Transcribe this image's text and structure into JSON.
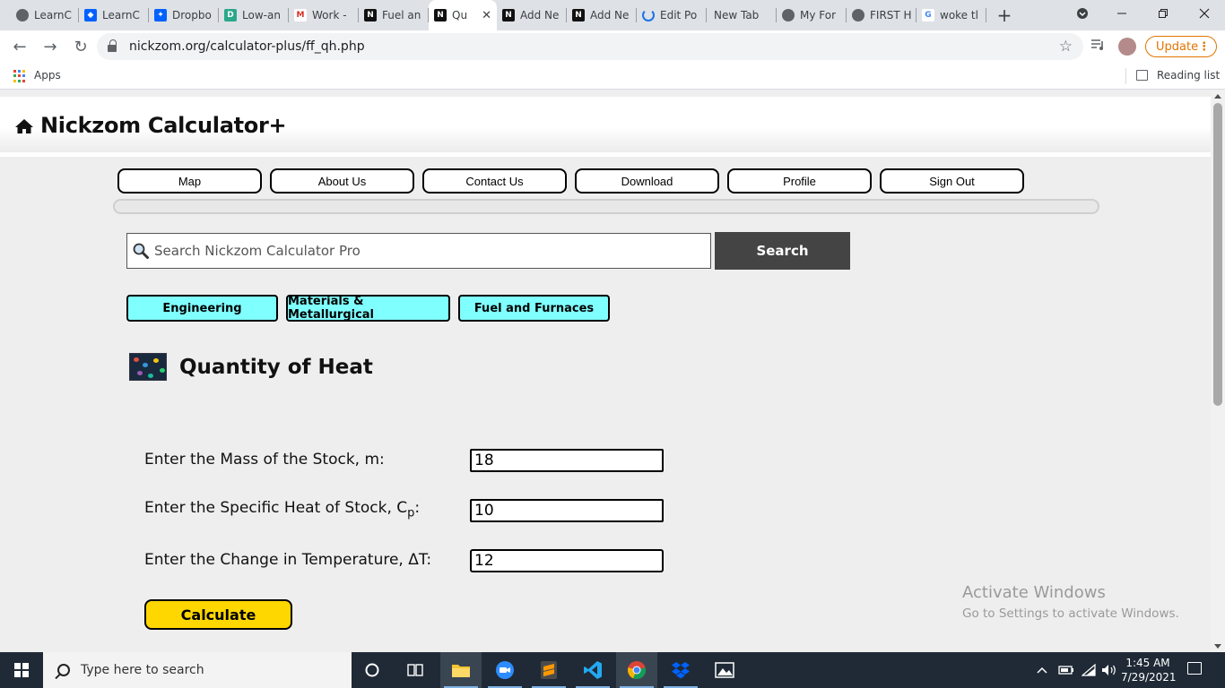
{
  "browser": {
    "tabs": [
      {
        "label": "LearnC",
        "favicon": "globe-icon"
      },
      {
        "label": "LearnC",
        "favicon": "box-icon"
      },
      {
        "label": "Dropbo",
        "favicon": "dropbox-icon"
      },
      {
        "label": "Low-an",
        "favicon": "d-icon"
      },
      {
        "label": "Work -",
        "favicon": "gmail-icon"
      },
      {
        "label": "Fuel an",
        "favicon": "nickzom-icon"
      },
      {
        "label": "Qu",
        "favicon": "nickzom-icon",
        "active": true,
        "close": "✕"
      },
      {
        "label": "Add Ne",
        "favicon": "nickzom-icon"
      },
      {
        "label": "Add Ne",
        "favicon": "nickzom-icon"
      },
      {
        "label": "Edit Po",
        "favicon": "loading-icon"
      },
      {
        "label": "New Tab",
        "favicon": ""
      },
      {
        "label": "My For",
        "favicon": "globe-icon"
      },
      {
        "label": "FIRST H",
        "favicon": "globe-icon"
      },
      {
        "label": "woke tl",
        "favicon": "google-icon"
      }
    ],
    "new_tab": "+",
    "url": "nickzom.org/calculator-plus/ff_qh.php",
    "update_label": "Update",
    "bookmarks": {
      "apps_label": "Apps",
      "reading_list_label": "Reading list"
    }
  },
  "site": {
    "title": "Nickzom Calculator+",
    "menu": [
      "Map",
      "About Us",
      "Contact Us",
      "Download",
      "Profile",
      "Sign Out"
    ],
    "search": {
      "placeholder": "Search Nickzom Calculator Pro",
      "button": "Search"
    },
    "categories": [
      "Engineering",
      "Materials & Metallurgical",
      "Fuel and Furnaces"
    ],
    "heading": "Quantity of Heat",
    "fields": {
      "mass": {
        "label": "Enter the Mass of the Stock, m:",
        "value": "18"
      },
      "specific_heat": {
        "label_main": "Enter the Specific Heat of Stock, C",
        "label_sub": "p",
        "label_tail": ":",
        "value": "10"
      },
      "temp_change": {
        "label": "Enter the Change in Temperature, ΔT:",
        "value": "12"
      }
    },
    "calculate_label": "Calculate"
  },
  "watermark": {
    "line1": "Activate Windows",
    "line2": "Go to Settings to activate Windows."
  },
  "taskbar": {
    "search_placeholder": "Type here to search",
    "time": "1:45 AM",
    "date": "7/29/2021"
  },
  "colors": {
    "category_bg": "#80ffff",
    "calculate_bg": "#ffd700",
    "search_btn_bg": "#444444",
    "update_accent": "#e37400"
  }
}
